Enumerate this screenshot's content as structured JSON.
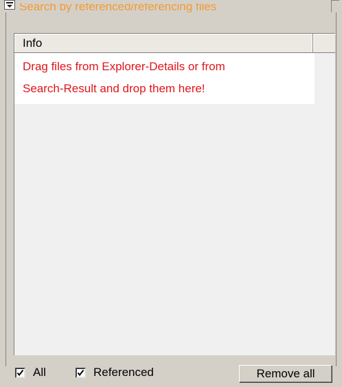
{
  "group": {
    "title": "Search by referenced/referencing files"
  },
  "list": {
    "columns": [
      "Info"
    ],
    "rows": [
      "Drag files from Explorer-Details or from",
      "Search-Result and drop them here!"
    ]
  },
  "footer": {
    "all_label": "All",
    "all_checked": true,
    "referenced_label": "Referenced",
    "referenced_checked": true,
    "remove_all_label": "Remove all"
  },
  "colors": {
    "title": "#f39a33",
    "info_text": "#e0141a",
    "panel": "#d4d0c8"
  }
}
